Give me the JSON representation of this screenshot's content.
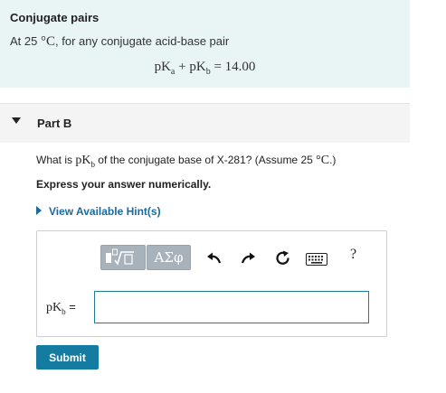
{
  "info": {
    "title": "Conjugate pairs",
    "line_prefix": "At 25",
    "line_suffix": ", for any conjugate acid-base pair",
    "degree_unit": "°C",
    "equation_lhs_a": "pK",
    "sub_a": "a",
    "plus": "+",
    "equation_lhs_b": "pK",
    "sub_b": "b",
    "equals": "=",
    "equation_value": "14.00"
  },
  "part": {
    "label": "Part B"
  },
  "question": {
    "prefix": "What is ",
    "math_pk": "pK",
    "math_sub": "b",
    "middle": " of the conjugate base of X-281? (Assume 25",
    "unit": "°C",
    "suffix": ".)",
    "express": "Express your answer numerically.",
    "hint_label": "View Available Hint(s)"
  },
  "toolbar": {
    "greek_label": "ΑΣφ",
    "help_label": "?",
    "icons": [
      "templates-icon",
      "greek-letters-icon",
      "undo-icon",
      "redo-icon",
      "reset-icon",
      "keyboard-icon",
      "help-icon"
    ]
  },
  "answer": {
    "label_pk": "pK",
    "label_sub": "b",
    "label_eq": "=",
    "value": ""
  },
  "submit_label": "Submit",
  "colors": {
    "info_bg": "#e9f4f5",
    "accent": "#167ba0",
    "link": "#1a6aa0",
    "toolbar_btn": "#a7b2bb"
  }
}
